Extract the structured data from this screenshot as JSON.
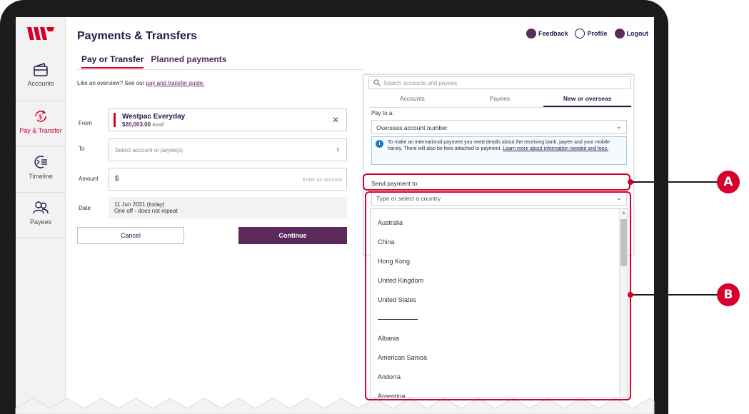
{
  "page": {
    "title": "Payments & Transfers"
  },
  "sidebar": {
    "items": [
      {
        "label": "Accounts",
        "icon": "wallet-icon"
      },
      {
        "label": "Pay & Transfer",
        "icon": "pay-transfer-icon"
      },
      {
        "label": "Timeline",
        "icon": "timeline-icon"
      },
      {
        "label": "Payees",
        "icon": "payees-icon"
      }
    ]
  },
  "top_links": {
    "feedback": "Feedback",
    "profile": "Profile",
    "logout": "Logout"
  },
  "tabs": [
    {
      "label": "Pay or Transfer"
    },
    {
      "label": "Planned payments"
    }
  ],
  "overview": {
    "text": "Like an overview? See our ",
    "link": "pay and transfer guide."
  },
  "form": {
    "from_label": "From",
    "from_account": "Westpac Everyday",
    "from_avail_amount": "$20,003.00",
    "from_avail_suffix": " avail",
    "to_label": "To",
    "to_placeholder": "Select account or payee(s)",
    "amount_label": "Amount",
    "amount_symbol": "$",
    "amount_placeholder": "Enter an amount",
    "date_label": "Date",
    "date_value": "11 Jun 2021 (today)",
    "date_sub": "One off - does not repeat",
    "cancel": "Cancel",
    "continue": "Continue"
  },
  "panel": {
    "search_placeholder": "Search accounts and payees",
    "tabs": [
      "Accounts",
      "Payees",
      "New or overseas"
    ],
    "pay_to_label": "Pay to a:",
    "pay_to_value": "Overseas account number",
    "info_text": "To make an international payment you need details about the receiving bank, payee and your mobile handy. There will also be fees attached to payment. ",
    "info_link": "Learn more about information needed and fees.",
    "send_to_label": "Send payment to:",
    "country_placeholder": "Type or select a country"
  },
  "countries_top": [
    "Australia",
    "China",
    "Hong Kong",
    "United Kingdom",
    "United States"
  ],
  "countries_all": [
    "Albania",
    "American Samoa",
    "Andorra",
    "Argentina"
  ],
  "callouts": {
    "a": "A",
    "b": "B"
  },
  "colors": {
    "brand_red": "#d5002b",
    "brand_purple": "#5b2a5a",
    "navy": "#1f1c4f"
  }
}
